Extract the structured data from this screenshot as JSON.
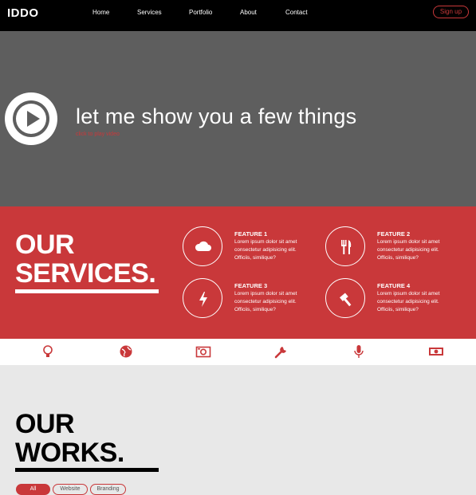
{
  "header": {
    "logo": "IDDO",
    "nav": [
      "Home",
      "Services",
      "Portfolio",
      "About",
      "Contact"
    ],
    "signup": "Sign up"
  },
  "hero": {
    "title": "let me show you a few things",
    "subtitle": "click to play video",
    "play_icon": "play-icon"
  },
  "services": {
    "title_line1": "OUR",
    "title_line2": "SERVICES.",
    "features": [
      {
        "name": "FEATURE 1",
        "desc": "Lorem ipsum dolor sit amet consectetur adipisicing elit. Officiis, similique?",
        "icon": "cloud-icon"
      },
      {
        "name": "FEATURE 2",
        "desc": "Lorem ipsum dolor sit amet consectetur adipisicing elit. Officiis, similique?",
        "icon": "fork-knife-icon"
      },
      {
        "name": "FEATURE 3",
        "desc": "Lorem ipsum dolor sit amet consectetur adipisicing elit. Officiis, similique?",
        "icon": "lightning-icon"
      },
      {
        "name": "FEATURE 4",
        "desc": "Lorem ipsum dolor sit amet consectetur adipisicing elit. Officiis, similique?",
        "icon": "hammer-icon"
      }
    ]
  },
  "iconbar": {
    "icons": [
      "lightbulb-icon",
      "globe-icon",
      "camera-icon",
      "wrench-icon",
      "microphone-icon",
      "money-icon"
    ]
  },
  "works": {
    "title_line1": "OUR",
    "title_line2": "WORKS.",
    "filters": [
      "All",
      "Website",
      "Branding"
    ]
  },
  "colors": {
    "accent": "#c9383a",
    "hero_bg": "#5e5e5e",
    "header_bg": "#000000",
    "works_bg": "#e8e8e8"
  }
}
